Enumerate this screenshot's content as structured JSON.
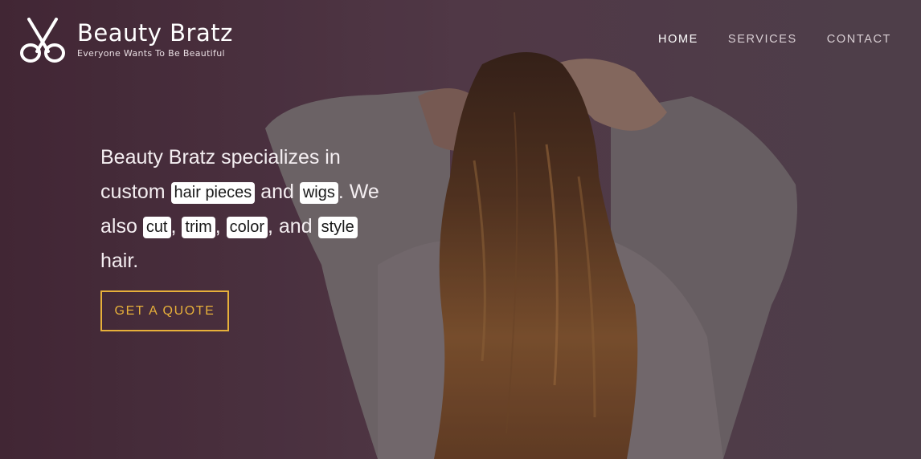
{
  "brand": {
    "name": "Beauty Bratz",
    "tagline": "Everyone Wants To Be Beautiful",
    "logo_icon": "scissors-icon"
  },
  "nav": {
    "items": [
      {
        "label": "HOME",
        "active": true
      },
      {
        "label": "SERVICES",
        "active": false
      },
      {
        "label": "CONTACT",
        "active": false
      }
    ]
  },
  "hero": {
    "intro_1": "Beauty Bratz specializes in custom ",
    "chip_hair_pieces": "hair pieces",
    "and_1": " and ",
    "chip_wigs": "wigs",
    "intro_2": ". We also ",
    "chip_cut": "cut",
    "comma_1": ", ",
    "chip_trim": "trim",
    "comma_2": ", ",
    "chip_color": "color",
    "and_2": ", and ",
    "chip_style": "style",
    "outro": " hair.",
    "cta_label": "GET A QUOTE"
  },
  "colors": {
    "accent": "#e7b03a",
    "chip_bg": "#ffffff",
    "nav_active": "#ffffff",
    "nav_inactive": "#d9cfd4"
  }
}
